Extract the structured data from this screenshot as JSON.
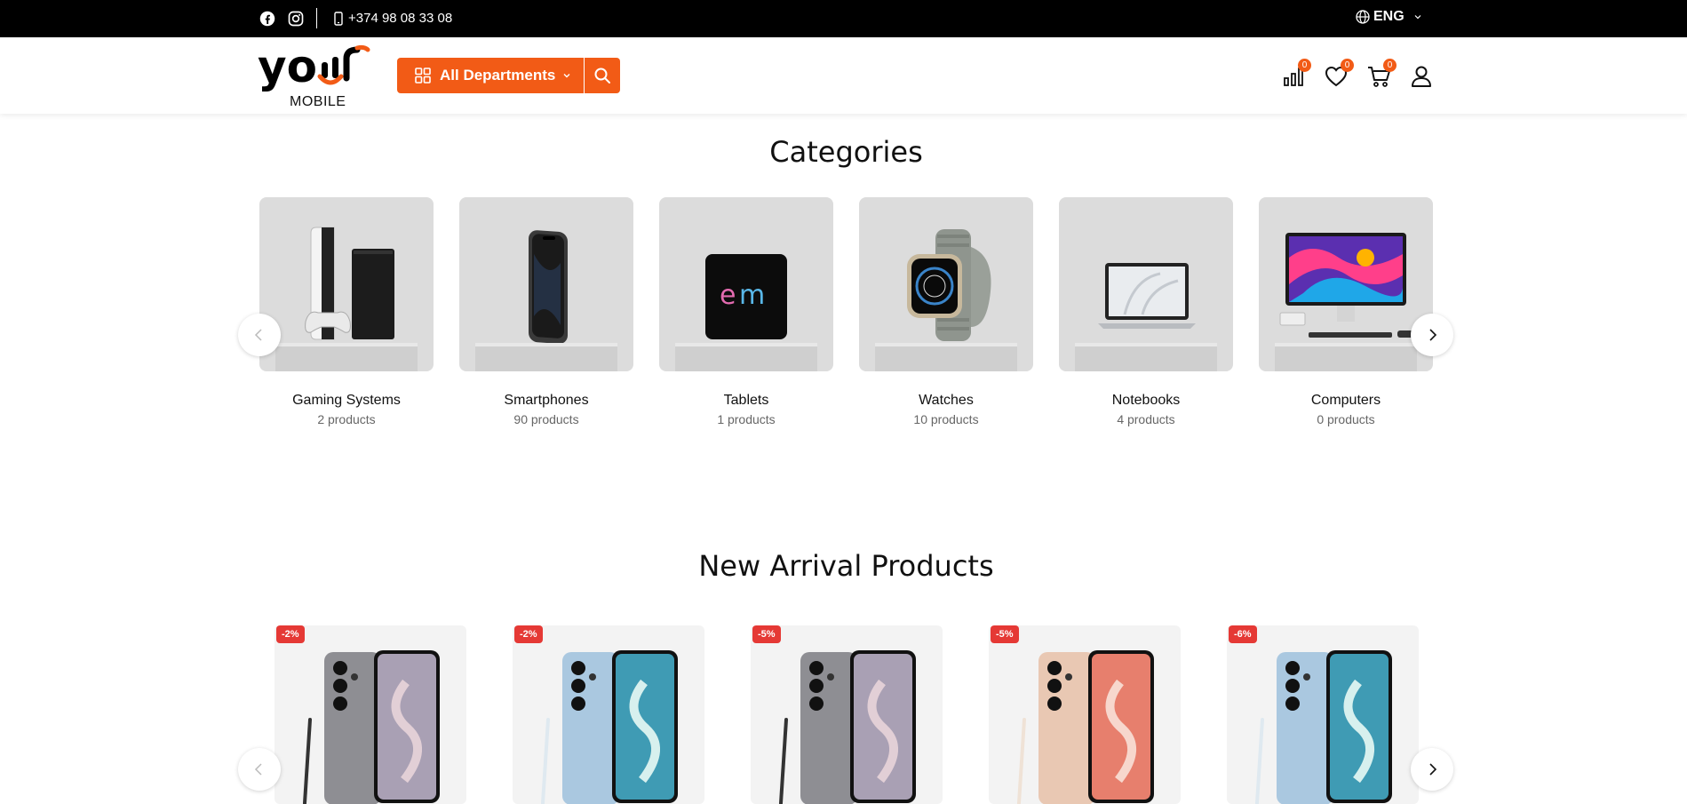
{
  "topbar": {
    "phone": "+374 98 08 33 08",
    "language": "ENG"
  },
  "header": {
    "logo_word": "yo",
    "logo_sub": "MOBILE",
    "departments_label": "All Departments",
    "compare_count": "0",
    "wishlist_count": "0",
    "cart_count": "0"
  },
  "categories": {
    "title": "Categories",
    "items": [
      {
        "name": "Gaming Systems",
        "count": "2 products",
        "icon": "console-icon"
      },
      {
        "name": "Smartphones",
        "count": "90 products",
        "icon": "smartphone-icon"
      },
      {
        "name": "Tablets",
        "count": "1 products",
        "icon": "tablet-icon"
      },
      {
        "name": "Watches",
        "count": "10 products",
        "icon": "watch-icon"
      },
      {
        "name": "Notebooks",
        "count": "4 products",
        "icon": "laptop-icon"
      },
      {
        "name": "Computers",
        "count": "0 products",
        "icon": "desktop-icon"
      }
    ]
  },
  "new_arrivals": {
    "title": "New Arrival Products",
    "items": [
      {
        "discount": "-2%",
        "color": "#8e8e93"
      },
      {
        "discount": "-2%",
        "color": "#aac8e0"
      },
      {
        "discount": "-5%",
        "color": "#8e8e93"
      },
      {
        "discount": "-5%",
        "color": "#e9c8b3"
      },
      {
        "discount": "-6%",
        "color": "#aac8e0"
      }
    ]
  },
  "colors": {
    "accent": "#f25b16",
    "badge_red": "#e53935"
  }
}
